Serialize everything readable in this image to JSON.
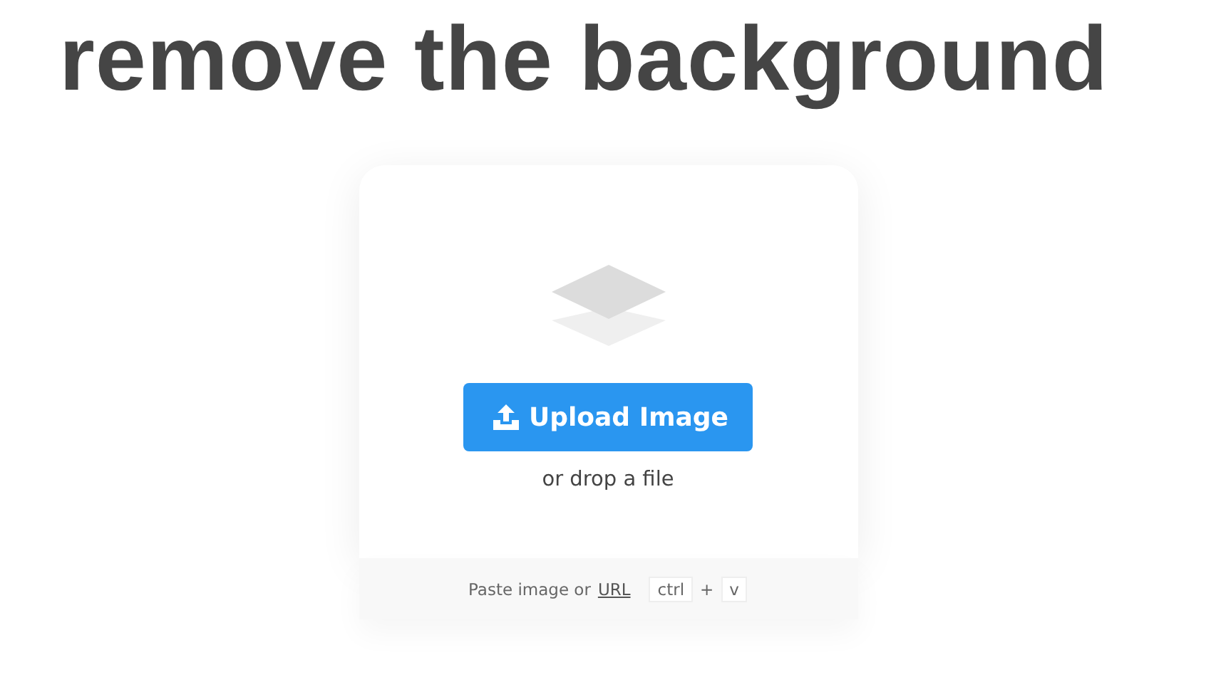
{
  "heading": "remove the background",
  "uploader": {
    "button": "Upload Image",
    "drop_hint": "or drop a file"
  },
  "paste_hint": {
    "text": "Paste image or",
    "link": "URL",
    "keys": [
      "ctrl",
      "v"
    ],
    "separator": "+"
  }
}
